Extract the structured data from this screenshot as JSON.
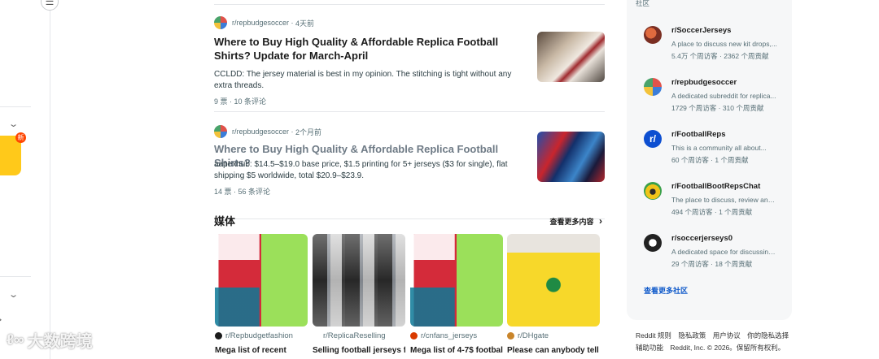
{
  "posts": [
    {
      "subreddit": "r/repbudgesoccer",
      "time": "4天前",
      "title": "Where to Buy High Quality & Affordable Replica Football Shirts? Update for March-April",
      "body": "CCLDD: The jersey material is best in my opinion. The stitching is tight without any extra threads.",
      "stats": "9 票 · 10 条评论"
    },
    {
      "subreddit": "r/repbudgesoccer",
      "time": "2个月前",
      "title": "Where to Buy High Quality & Affordable Replica Football Shirts?",
      "body": "aapexhub: $14.5–$19.0 base price, $1.5 printing for 5+ jerseys ($3 for single), flat shipping $5 worldwide, total $20.9–$23.9.",
      "stats": "14 票 · 56 条评论"
    }
  ],
  "media": {
    "title": "媒体",
    "see_more": "查看更多内容",
    "items": [
      {
        "subreddit": "r/Repbudgetfashion",
        "caption": "Mega list of recent"
      },
      {
        "subreddit": "r/ReplicaReselling",
        "caption": "Selling football jerseys for"
      },
      {
        "subreddit": "r/cnfans_jerseys",
        "caption": "Mega list of 4-7$ football"
      },
      {
        "subreddit": "r/DHgate",
        "caption": "Please can anybody tell"
      }
    ]
  },
  "sidebar": {
    "label": "社区",
    "communities": [
      {
        "name": "r/SoccerJerseys",
        "desc": "A place to discuss new kit drops,...",
        "stats": "5.4万 个周访客 · 2362 个周贡献"
      },
      {
        "name": "r/repbudgesoccer",
        "desc": "A dedicated subreddit for replica...",
        "stats": "1729 个周访客 · 310 个周贡献"
      },
      {
        "name": "r/FootballReps",
        "desc": "This is a community all about...",
        "stats": "60 个周访客 · 1 个周贡献"
      },
      {
        "name": "r/FootballBootRepsChat",
        "desc": "The place to discuss, review and...",
        "stats": "494 个周访客 · 1 个周贡献"
      },
      {
        "name": "r/soccerjerseys0",
        "desc": "A dedicated space for discussing...",
        "stats": "29 个周访客 · 18 个周贡献"
      }
    ],
    "see_more": "查看更多社区"
  },
  "footer": {
    "links": [
      "Reddit 规则",
      "隐私政策",
      "用户协议",
      "你的隐私选择"
    ],
    "line2": [
      "辅助功能",
      "Reddit, Inc. © 2026。保留所有权利。"
    ]
  },
  "rail": {
    "badge": "新"
  },
  "watermark": "大数跨境"
}
